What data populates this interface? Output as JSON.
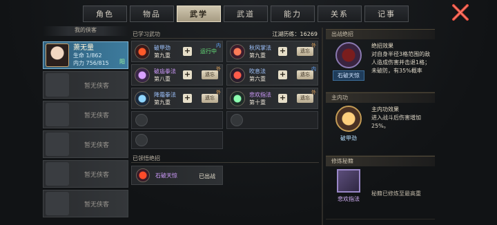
{
  "tabs": [
    "角色",
    "物品",
    "武学",
    "武道",
    "能力",
    "关系",
    "记事"
  ],
  "active_tab": "武学",
  "left": {
    "title": "我的侠客",
    "hero": {
      "name": "萧无量",
      "hp": "生命 1/862",
      "mp": "内力 756/815",
      "tag": "阳"
    },
    "empty_label": "暂无侠客",
    "empty_slots": [
      "暂无侠客",
      "暂无侠客",
      "暂无侠客",
      "暂无侠客",
      "暂无侠客"
    ]
  },
  "middle": {
    "learned_title": "已学习武功",
    "xp_label": "江湖历练：",
    "xp_value": "16269",
    "skills": [
      {
        "name": "破甲劲",
        "level": "第九重",
        "action": "运行中",
        "tag": "内",
        "tag_type": "in",
        "color": "blue",
        "icon": "fist-flame-icon"
      },
      {
        "name": "秋风掌法",
        "level": "第九重",
        "action": "遗忘",
        "tag": "外",
        "tag_type": "out",
        "color": "blue",
        "icon": "palm-icon"
      },
      {
        "name": "破庙拳法",
        "level": "第八重",
        "action": "遗忘",
        "tag": "外",
        "tag_type": "out",
        "color": "purple",
        "icon": "fist-icon"
      },
      {
        "name": "吹息法",
        "level": "第六重",
        "action": "遗忘",
        "tag": "内",
        "tag_type": "in",
        "color": "blue",
        "icon": "breath-icon"
      },
      {
        "name": "降霜拳法",
        "level": "第九重",
        "action": "遗忘",
        "tag": "外",
        "tag_type": "out",
        "color": "blue",
        "icon": "frost-fist-icon"
      },
      {
        "name": "悲欢指法",
        "level": "第十重",
        "action": "遗忘",
        "tag": "外",
        "tag_type": "out",
        "color": "purple",
        "icon": "finger-icon"
      }
    ],
    "ult_title": "已领悟绝招",
    "ult": {
      "name": "石破天惊",
      "status": "已出战"
    }
  },
  "right": {
    "battle_title": "出战绝招",
    "battle_skill": "石破天惊",
    "battle_desc_head": "绝招效果",
    "battle_desc": "对自身半径3格范围的敌人造成伤害并击退1格；未破防，有35%概率",
    "inner_title": "主内功",
    "inner_skill": "破甲劲",
    "inner_desc_head": "主内功效果",
    "inner_desc": "进入战斗后伤害增加25%。",
    "cultivate_title": "修炼秘籍",
    "cultivate_skill": "悲欢指法",
    "cultivate_desc": "秘籍已修炼至最高重"
  },
  "colors": {
    "accent": "#cfc6b0",
    "hero_card": "#3d7b9d",
    "status_running": "#66e27a",
    "close": "#e04a3c"
  }
}
